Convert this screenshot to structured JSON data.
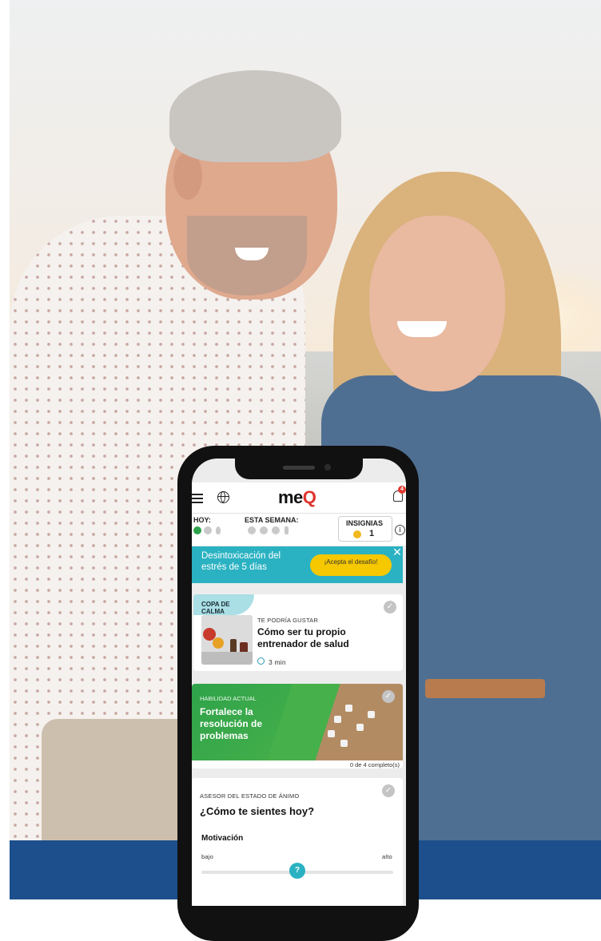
{
  "app": {
    "logo_text": "me",
    "logo_q": "Q",
    "notification_count": "4"
  },
  "status": {
    "today_label": "HOY:",
    "week_label": "ESTA SEMANA:",
    "badges_label": "INSIGNIAS",
    "badges_count": "1",
    "info_glyph": "i"
  },
  "challenge": {
    "title": "Desintoxicación del estrés de 5 días",
    "button_label": "¡Acepta el desafío!",
    "close_glyph": "✕"
  },
  "recommendation": {
    "category": "COPA DE CALMA",
    "subtitle": "TE PODRÍA GUSTAR",
    "title": "Cómo ser tu propio entrenador de salud",
    "duration": "3 min",
    "check_glyph": "✓"
  },
  "skill": {
    "label": "HABILIDAD ACTUAL",
    "title": "Fortalece la resolución de problemas",
    "progress": "0 de 4 completo(s)",
    "check_glyph": "✓"
  },
  "mood": {
    "section_label": "ASESOR DEL ESTADO DE ÁNIMO",
    "question": "¿Cómo te sientes hoy?",
    "metric_label": "Motivación",
    "low_label": "bajo",
    "high_label": "alto",
    "knob_glyph": "?",
    "check_glyph": "✓"
  },
  "colors": {
    "brand_blue": "#1d4f8c",
    "teal": "#2bb2c2",
    "yellow": "#f6c800",
    "green": "#2fa34a",
    "logo_red": "#e0322b"
  }
}
